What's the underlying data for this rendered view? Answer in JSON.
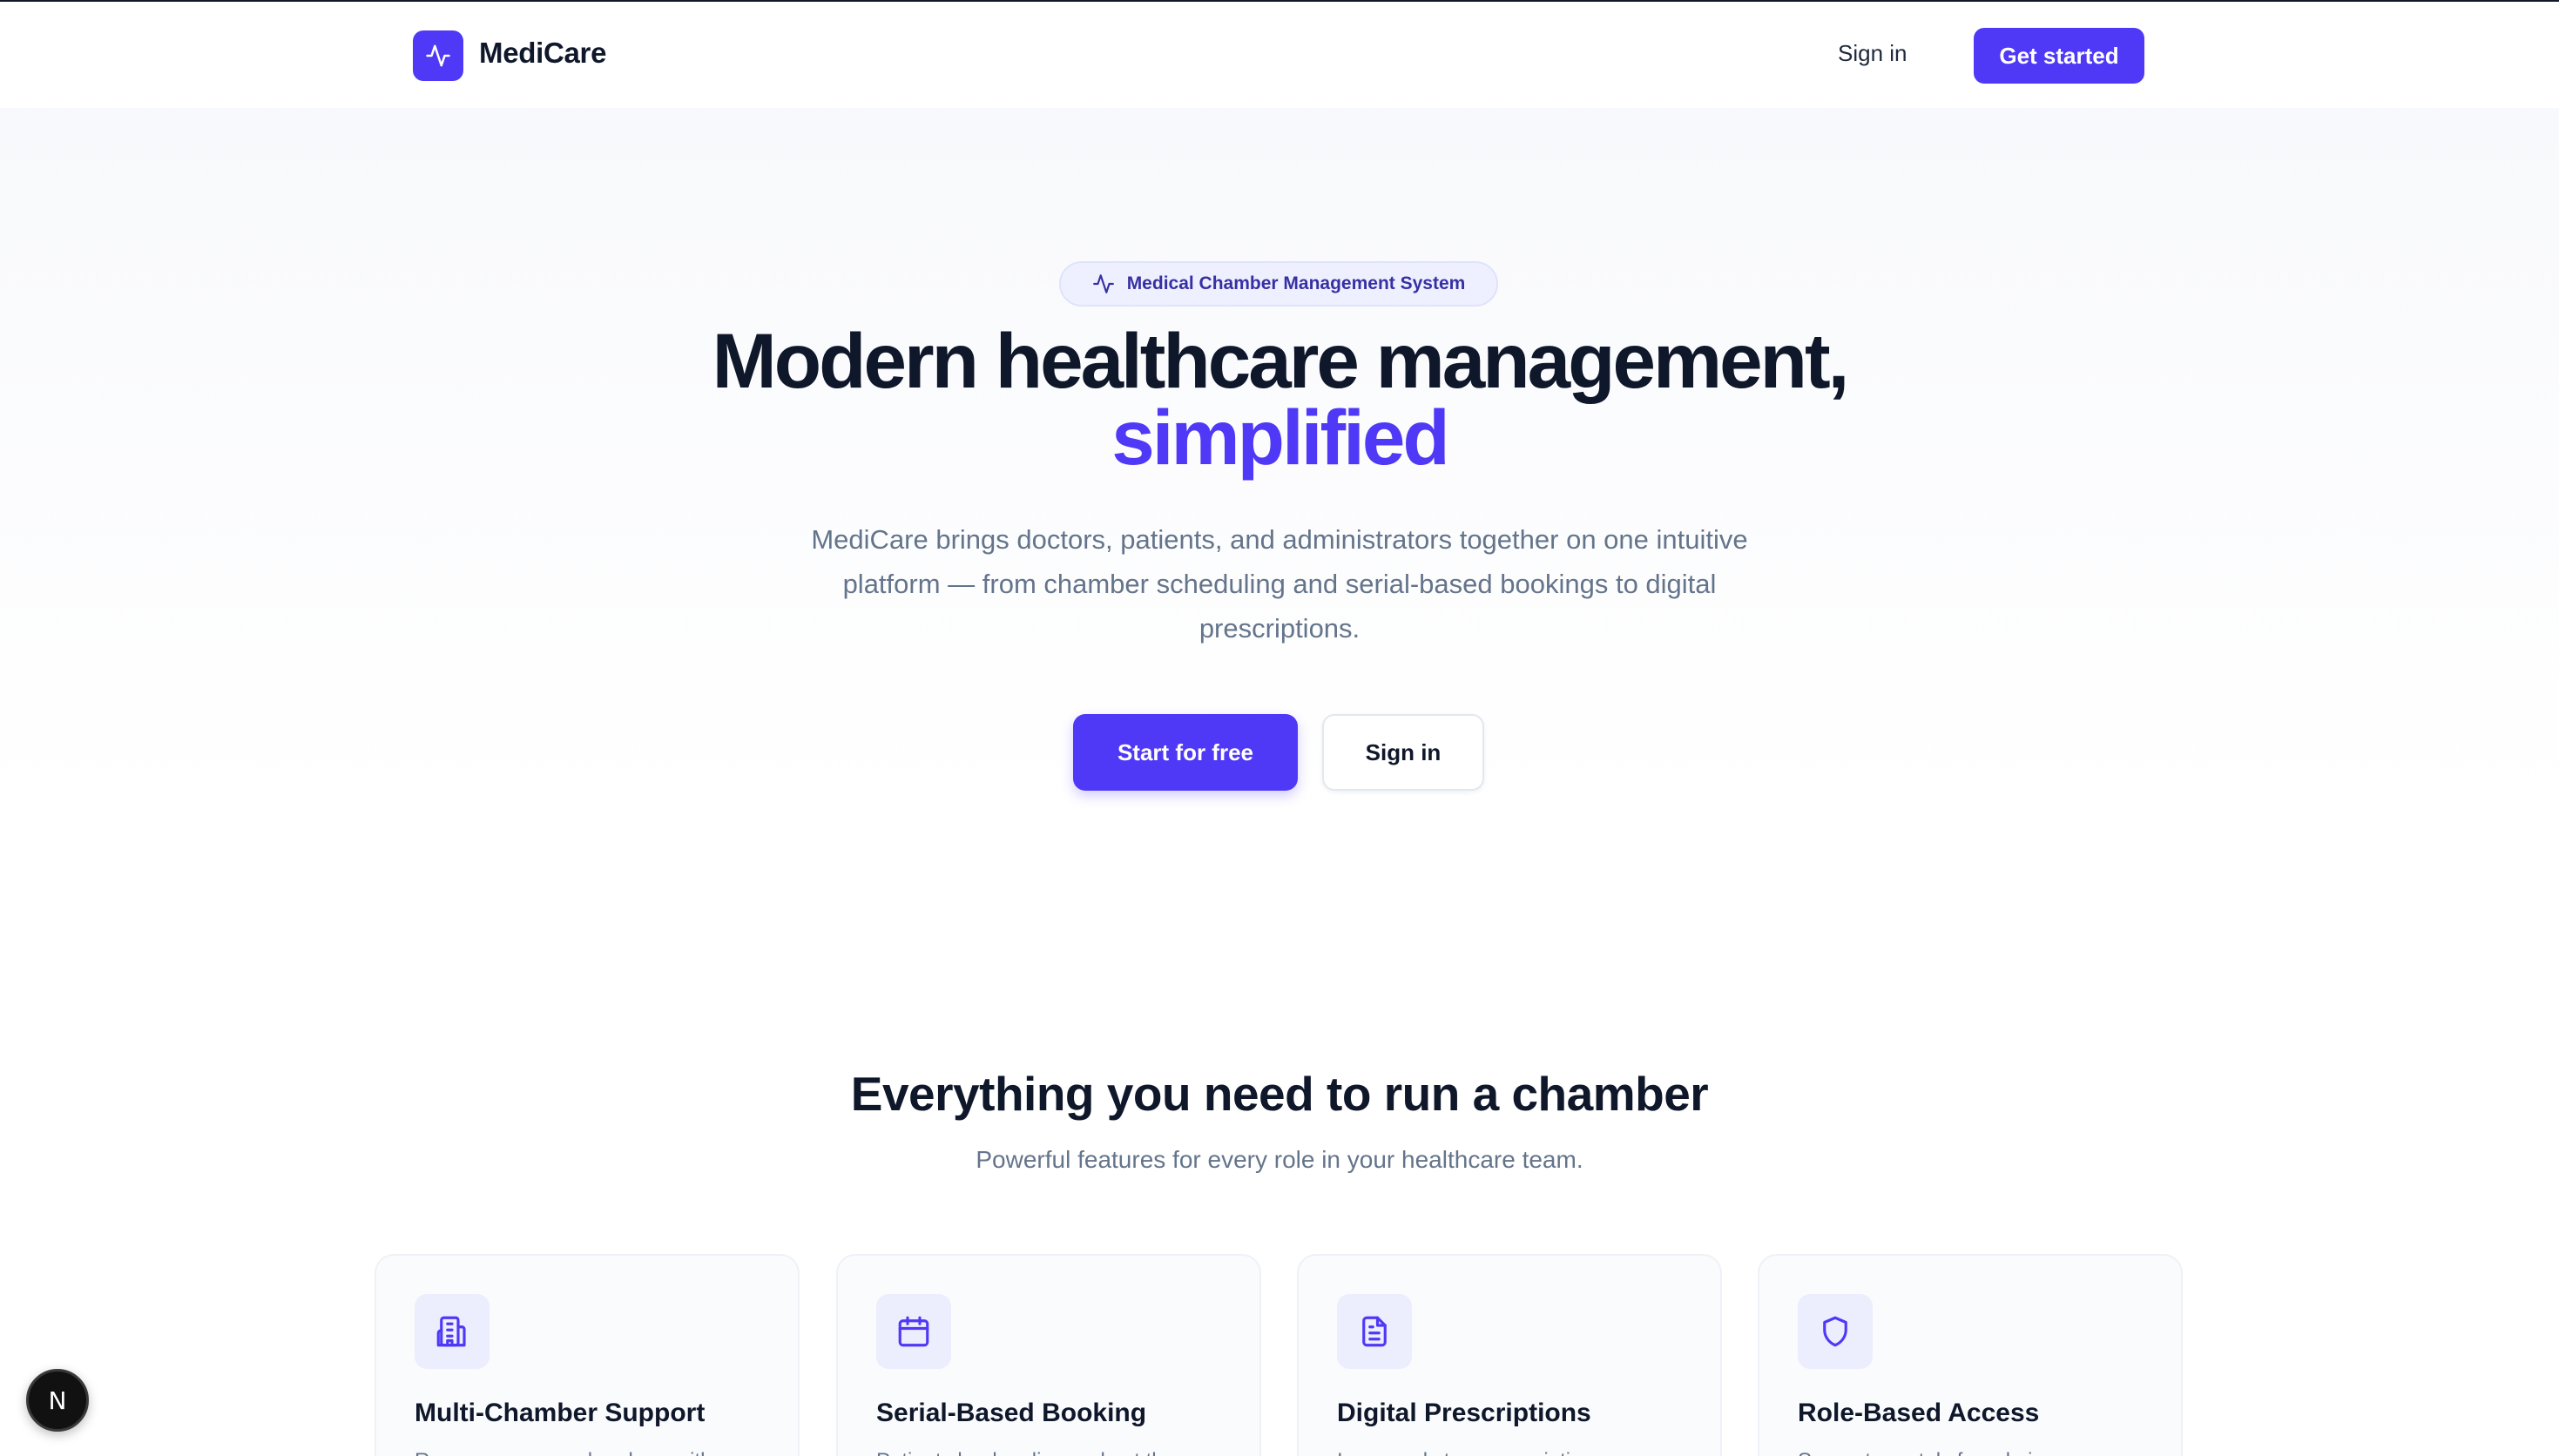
{
  "colors": {
    "accent": "#4f39f6",
    "text": "#0f172a",
    "muted": "#64748b"
  },
  "header": {
    "brand": "MediCare",
    "logo_icon": "activity-pulse-icon",
    "sign_in": "Sign in",
    "get_started": "Get started"
  },
  "hero": {
    "badge_icon": "activity-pulse-icon",
    "badge": "Medical Chamber Management System",
    "title_line1": "Modern healthcare management,",
    "title_line2": "simplified",
    "description": "MediCare brings doctors, patients, and administrators together on one intuitive platform — from chamber scheduling and serial-based bookings to digital prescriptions.",
    "primary_cta": "Start for free",
    "secondary_cta": "Sign in"
  },
  "features": {
    "title": "Everything you need to run a chamber",
    "subtitle": "Powerful features for every role in your healthcare team.",
    "items": [
      {
        "icon": "building-icon",
        "title": "Multi-Chamber Support",
        "desc": "Run one or more chambers with"
      },
      {
        "icon": "calendar-icon",
        "title": "Serial-Based Booking",
        "desc": "Patients book online and get the"
      },
      {
        "icon": "file-text-icon",
        "title": "Digital Prescriptions",
        "desc": "Issue and store prescriptions"
      },
      {
        "icon": "shield-icon",
        "title": "Role-Based Access",
        "desc": "Separate portals for admins"
      }
    ]
  },
  "dev_badge": {
    "label": "N",
    "icon": "nextjs-icon"
  }
}
